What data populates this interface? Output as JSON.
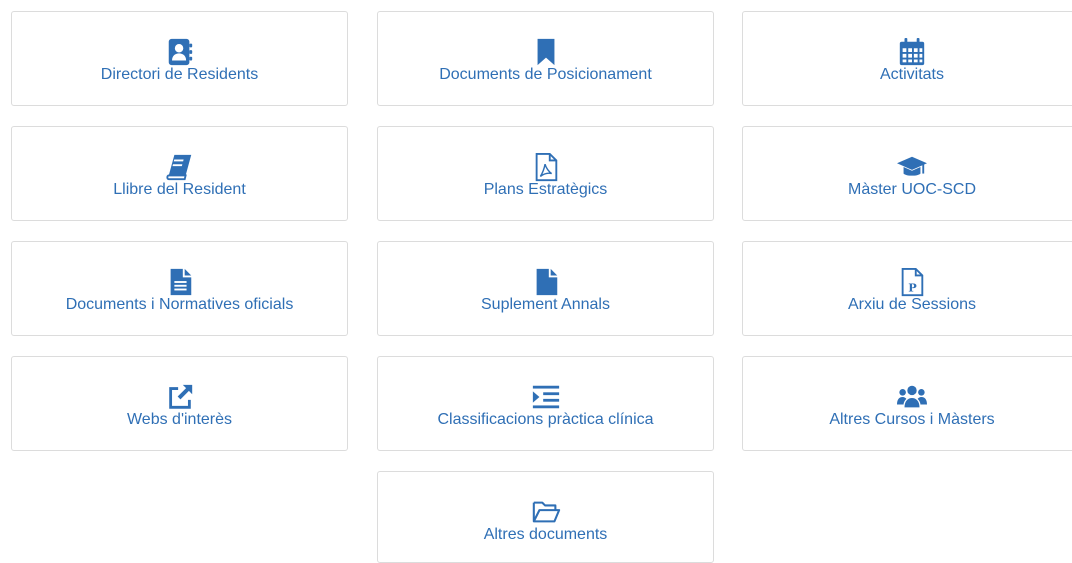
{
  "tiles": [
    {
      "label": "Directori de Residents",
      "icon": "address-book-icon"
    },
    {
      "label": "Documents de Posicionament",
      "icon": "bookmark-icon"
    },
    {
      "label": "Activitats",
      "icon": "calendar-icon"
    },
    {
      "label": "Llibre del Resident",
      "icon": "book-icon"
    },
    {
      "label": "Plans Estratègics",
      "icon": "pdf-file-icon"
    },
    {
      "label": "Màster UOC-SCD",
      "icon": "graduation-cap-icon"
    },
    {
      "label": "Documents i Normatives oficials",
      "icon": "file-text-icon"
    },
    {
      "label": "Suplement Annals",
      "icon": "file-icon"
    },
    {
      "label": "Arxiu de Sessions",
      "icon": "powerpoint-file-icon"
    },
    {
      "label": "Webs d'interès",
      "icon": "external-link-icon"
    },
    {
      "label": "Classificacions pràctica clínica",
      "icon": "indent-icon"
    },
    {
      "label": "Altres Cursos i Màsters",
      "icon": "users-icon"
    },
    {
      "label": "Altres documents",
      "icon": "folder-open-icon"
    }
  ],
  "colors": {
    "accent": "#2f6fb5",
    "border": "#dcdcdc"
  }
}
